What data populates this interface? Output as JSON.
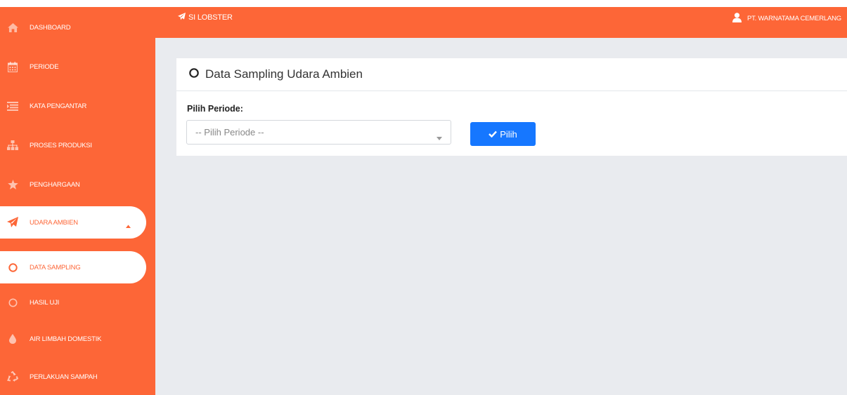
{
  "header": {
    "brand": "SI LOBSTER",
    "user": "PT. WARNATAMA CEMERLANG"
  },
  "sidebar": {
    "items": [
      {
        "label": "DASHBOARD",
        "icon": "home-icon"
      },
      {
        "label": "PERIODE",
        "icon": "calendar-icon"
      },
      {
        "label": "KATA PENGANTAR",
        "icon": "list-icon"
      },
      {
        "label": "PROSES PRODUKSI",
        "icon": "sitemap-icon"
      },
      {
        "label": "PENGHARGAAN",
        "icon": "star-icon"
      },
      {
        "label": "UDARA AMBIEN",
        "icon": "paper-plane-icon",
        "state": "open"
      },
      {
        "label": "DATA SAMPLING",
        "icon": "circle-icon",
        "state": "active"
      },
      {
        "label": "HASIL UJI",
        "icon": "circle-icon"
      },
      {
        "label": "AIR LIMBAH DOMESTIK",
        "icon": "tint-icon"
      },
      {
        "label": "PERLAKUAN SAMPAH",
        "icon": "recycle-icon"
      }
    ]
  },
  "main": {
    "card_title": "Data Sampling Udara Ambien",
    "field_label": "Pilih Periode:",
    "select_placeholder": "-- Pilih Periode --",
    "button_label": "Pilih"
  },
  "colors": {
    "brand": "#fd6637",
    "background": "#e9ebef",
    "button": "#1677ff"
  }
}
